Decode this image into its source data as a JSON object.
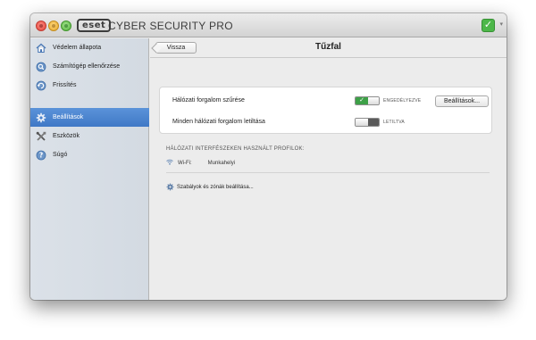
{
  "app": {
    "logo_text": "eset",
    "product_name": "CYBER SECURITY PRO",
    "status_check": "✓",
    "status_caret": "▾"
  },
  "colors": {
    "accent": "#3f78c6",
    "toggle_on": "#3da047",
    "status_ok": "#4db749"
  },
  "sidebar": {
    "items": [
      {
        "label": "Védelem állapota",
        "icon": "home-icon"
      },
      {
        "label": "Számítógép ellenőrzése",
        "icon": "scan-icon"
      },
      {
        "label": "Frissítés",
        "icon": "refresh-icon"
      },
      {
        "label": "Beállítások",
        "icon": "gear-icon",
        "active": true
      },
      {
        "label": "Eszközök",
        "icon": "tools-icon"
      },
      {
        "label": "Súgó",
        "icon": "help-icon"
      }
    ]
  },
  "header": {
    "back_label": "Vissza",
    "title": "Tűzfal"
  },
  "panel": {
    "rows": [
      {
        "label": "Hálózati forgalom szűrése",
        "state": "ENGEDÉLYEZVE",
        "enabled": true,
        "button": "Beállítások..."
      },
      {
        "label": "Minden hálózati forgalom letiltása",
        "state": "LETILTVA",
        "enabled": false
      }
    ]
  },
  "profiles": {
    "section_label": "HÁLÓZATI INTERFÉSZEKEN HASZNÁLT PROFILOK:",
    "interface": "Wi-Fi:",
    "profile": "Munkahelyi"
  },
  "rules_link": "Szabályok és zónák beállítása..."
}
